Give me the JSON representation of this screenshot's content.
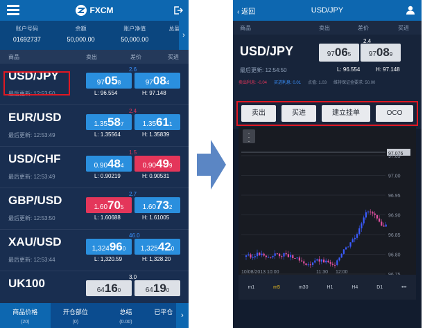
{
  "left": {
    "title": "FXCM",
    "account": {
      "cols": [
        {
          "h": "账户号码",
          "v": "01692737"
        },
        {
          "h": "余额",
          "v": "50,000.00"
        },
        {
          "h": "账户净值",
          "v": "50,000.00"
        },
        {
          "h": "总盈/",
          "v": ""
        }
      ]
    },
    "thead": [
      "商品",
      "卖出",
      "差价",
      "买进"
    ],
    "rows": [
      {
        "sym": "USD/JPY",
        "upd": "最后更新: 12:53:50",
        "low": "L: 96.554",
        "high": "H: 97.148",
        "spr": "2.6",
        "sell": [
          "97",
          "05",
          "8"
        ],
        "buy": [
          "97",
          "08",
          "4"
        ],
        "sellc": "blue",
        "buyc": "blue",
        "sprc": "#3a92ff"
      },
      {
        "sym": "EUR/USD",
        "upd": "最后更新: 12:53:49",
        "low": "L: 1.35564",
        "high": "H: 1.35839",
        "spr": "2.4",
        "sell": [
          "1.35",
          "58",
          "7"
        ],
        "buy": [
          "1.35",
          "61",
          "1"
        ],
        "sellc": "blue",
        "buyc": "blue",
        "sprc": "#e4365a"
      },
      {
        "sym": "USD/CHF",
        "upd": "最后更新: 12:53:49",
        "low": "L: 0.90219",
        "high": "H: 0.90531",
        "spr": "1.5",
        "sell": [
          "0.90",
          "48",
          "4"
        ],
        "buy": [
          "0.90",
          "49",
          "9"
        ],
        "sellc": "blue",
        "buyc": "red",
        "sprc": "#e4365a"
      },
      {
        "sym": "GBP/USD",
        "upd": "最后更新: 12:53:50",
        "low": "L: 1.60688",
        "high": "H: 1.61005",
        "spr": "2.7",
        "sell": [
          "1.60",
          "70",
          "5"
        ],
        "buy": [
          "1.60",
          "73",
          "2"
        ],
        "sellc": "red",
        "buyc": "blue",
        "sprc": "#3a92ff"
      },
      {
        "sym": "XAU/USD",
        "upd": "最后更新: 12:53:44",
        "low": "L: 1,320.59",
        "high": "H: 1,328.20",
        "spr": "46.0",
        "sell": [
          "1,324",
          "96",
          "0"
        ],
        "buy": [
          "1,325",
          "42",
          "0"
        ],
        "sellc": "blue",
        "buyc": "blue",
        "sprc": "#3a92ff"
      },
      {
        "sym": "UK100",
        "upd": "",
        "low": "",
        "high": "",
        "spr": "3.0",
        "sell": [
          "64",
          "16",
          "0"
        ],
        "buy": [
          "64",
          "19",
          "0"
        ],
        "sellc": "gray",
        "buyc": "gray",
        "sprc": "#fff"
      }
    ],
    "tabs": [
      {
        "n": "商品价格",
        "k": "(20)"
      },
      {
        "n": "开仓部位",
        "k": "(0)"
      },
      {
        "n": "总结",
        "k": "(0.00)"
      },
      {
        "n": "已平仓",
        "k": ""
      }
    ]
  },
  "right": {
    "back": "返回",
    "title": "USD/JPY",
    "thead": [
      "商品",
      "卖出",
      "差价",
      "买进"
    ],
    "sym": "USD/JPY",
    "upd": "最后更新: 12:54:50",
    "low": "L: 96.554",
    "high": "H: 97.148",
    "spr": "2.4",
    "sell": [
      "97",
      "06",
      "5"
    ],
    "buy": [
      "97",
      "08",
      "9"
    ],
    "info": [
      "卖出利息: -0.04",
      "买进利息: 0.01",
      "点值: 1.03",
      "维持保证金要求: 50.00"
    ],
    "buttons": [
      "卖出",
      "买进",
      "建立挂单",
      "OCO"
    ],
    "chart": {
      "price_labels": [
        "97.076",
        "97.05",
        "97.00",
        "96.95",
        "96.90",
        "96.85",
        "96.80",
        "96.75"
      ],
      "x_labels": [
        "10/08/2013 10:00",
        "11:30",
        "12:00"
      ]
    },
    "timeframes": [
      "m1",
      "m5",
      "m30",
      "H1",
      "H4",
      "D1",
      "•••"
    ]
  },
  "colors": {
    "topbar": "#0d67b0",
    "buy_blue": "#2a8fde",
    "sell_red": "#e4365a",
    "highlight": "#e01822"
  }
}
